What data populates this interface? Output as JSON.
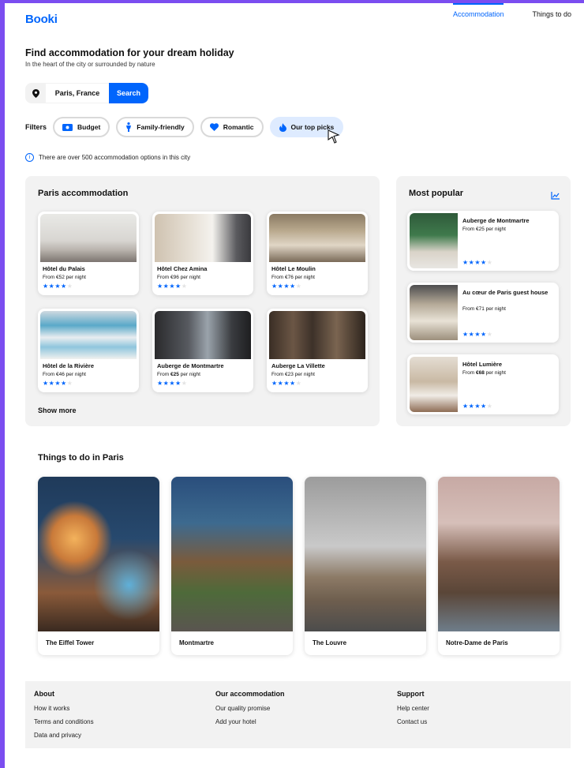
{
  "header": {
    "logo": "Booki",
    "nav": [
      "Accommodation",
      "Things to do"
    ]
  },
  "hero": {
    "title": "Find accommodation for your dream holiday",
    "subtitle": "In the heart of the city or surrounded by nature"
  },
  "search": {
    "icon": "location-pin-icon",
    "value": "Paris, France",
    "button": "Search"
  },
  "filters": {
    "label": "Filters",
    "items": [
      {
        "label": "Budget",
        "icon": "money-icon",
        "active": false
      },
      {
        "label": "Family-friendly",
        "icon": "person-icon",
        "active": false
      },
      {
        "label": "Romantic",
        "icon": "heart-icon",
        "active": false
      },
      {
        "label": "Our top picks",
        "icon": "flame-icon",
        "active": true
      }
    ]
  },
  "info": "There are over 500 accommodation options in this city",
  "accommodation": {
    "title": "Paris accommodation",
    "show_more": "Show more",
    "cards": [
      {
        "name": "Hôtel du Palais",
        "price_prefix": "From ",
        "price": "€52",
        "price_suffix": " per night",
        "rating": 4
      },
      {
        "name": "Hôtel Chez Amina",
        "price_prefix": "From ",
        "price": "€96",
        "price_suffix": " per night",
        "rating": 4
      },
      {
        "name": "Hôtel Le Moulin",
        "price_prefix": "From ",
        "price": "€76",
        "price_suffix": " per night",
        "rating": 4
      },
      {
        "name": "Hôtel de la Rivière",
        "price_prefix": "From ",
        "price": "€46",
        "price_suffix": " per night",
        "rating": 4
      },
      {
        "name": "Auberge de Montmartre",
        "price_prefix": "From ",
        "price": "€25",
        "price_suffix": " per night",
        "rating": 4
      },
      {
        "name": "Auberge La Villette",
        "price_prefix": "From ",
        "price": "€23",
        "price_suffix": " per night",
        "rating": 4
      }
    ]
  },
  "popular": {
    "title": "Most popular",
    "icon": "trend-chart-icon",
    "cards": [
      {
        "name": "Auberge de Montmartre",
        "price_prefix": "From ",
        "price": "€25",
        "price_suffix": " per night",
        "rating": 4
      },
      {
        "name": "Au cœur de Paris guest house",
        "price_prefix": "From ",
        "price": "€71",
        "price_suffix": " per night",
        "rating": 4
      },
      {
        "name": "Hôtel Lumière",
        "price_prefix": "From ",
        "price": "€68",
        "price_suffix": " per night",
        "rating": 4
      }
    ]
  },
  "things": {
    "title": "Things to do in Paris",
    "cards": [
      "The Eiffel Tower",
      "Montmartre",
      "The Louvre",
      "Notre-Dame de Paris"
    ]
  },
  "footer": {
    "columns": [
      {
        "title": "About",
        "links": [
          "How it works",
          "Terms and conditions",
          "Data and privacy"
        ]
      },
      {
        "title": "Our accommodation",
        "links": [
          "Our quality promise",
          "Add your hotel"
        ]
      },
      {
        "title": "Support",
        "links": [
          "Help center",
          "Contact us"
        ]
      }
    ]
  },
  "colors": {
    "brand": "#0065fc",
    "chip_active": "#deebff",
    "panel_bg": "#f2f2f2",
    "outer_frame": "#7b4df0"
  }
}
